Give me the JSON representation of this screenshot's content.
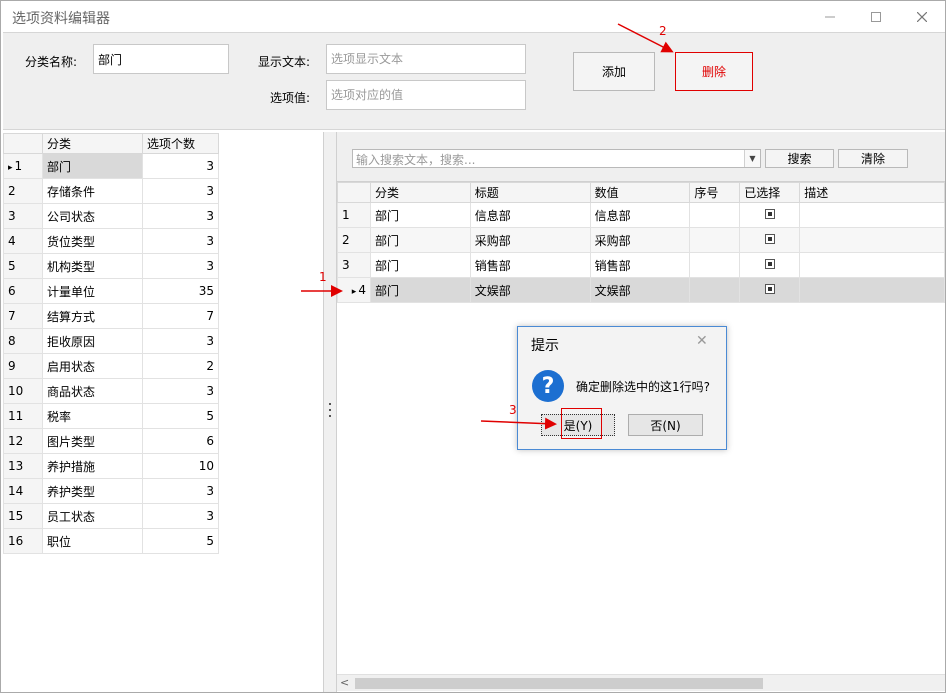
{
  "window": {
    "title": "选项资料编辑器",
    "min_glyph": "—",
    "max_glyph": "☐",
    "close_glyph": "✕"
  },
  "form": {
    "category_label": "分类名称:",
    "category_value": "部门",
    "display_label": "显示文本:",
    "display_placeholder": "选项显示文本",
    "value_label": "选项值:",
    "value_placeholder": "选项对应的值",
    "add_button": "添加",
    "delete_button": "删除"
  },
  "left_grid": {
    "columns": [
      "分类",
      "选项个数"
    ],
    "current_row_marker": "▸",
    "rows": [
      {
        "no": "1",
        "name": "部门",
        "count": "3"
      },
      {
        "no": "2",
        "name": "存储条件",
        "count": "3"
      },
      {
        "no": "3",
        "name": "公司状态",
        "count": "3"
      },
      {
        "no": "4",
        "name": "货位类型",
        "count": "3"
      },
      {
        "no": "5",
        "name": "机构类型",
        "count": "3"
      },
      {
        "no": "6",
        "name": "计量单位",
        "count": "35"
      },
      {
        "no": "7",
        "name": "结算方式",
        "count": "7"
      },
      {
        "no": "8",
        "name": "拒收原因",
        "count": "3"
      },
      {
        "no": "9",
        "name": "启用状态",
        "count": "2"
      },
      {
        "no": "10",
        "name": "商品状态",
        "count": "3"
      },
      {
        "no": "11",
        "name": "税率",
        "count": "5"
      },
      {
        "no": "12",
        "name": "图片类型",
        "count": "6"
      },
      {
        "no": "13",
        "name": "养护措施",
        "count": "10"
      },
      {
        "no": "14",
        "name": "养护类型",
        "count": "3"
      },
      {
        "no": "15",
        "name": "员工状态",
        "count": "3"
      },
      {
        "no": "16",
        "name": "职位",
        "count": "5"
      }
    ]
  },
  "search": {
    "placeholder": "输入搜索文本，搜索...",
    "search_button": "搜索",
    "clear_button": "清除",
    "dropdown_glyph": "▼"
  },
  "right_grid": {
    "columns": [
      "分类",
      "标题",
      "数值",
      "序号",
      "已选择",
      "描述"
    ],
    "current_row_marker": "▸",
    "rows": [
      {
        "no": "1",
        "category": "部门",
        "title": "信息部",
        "value": "信息部",
        "seq": "",
        "checked": true,
        "desc": ""
      },
      {
        "no": "2",
        "category": "部门",
        "title": "采购部",
        "value": "采购部",
        "seq": "",
        "checked": true,
        "desc": ""
      },
      {
        "no": "3",
        "category": "部门",
        "title": "销售部",
        "value": "销售部",
        "seq": "",
        "checked": true,
        "desc": ""
      },
      {
        "no": "4",
        "category": "部门",
        "title": "文娱部",
        "value": "文娱部",
        "seq": "",
        "checked": true,
        "desc": ""
      }
    ],
    "scroll_left_glyph": "<"
  },
  "dialog": {
    "title": "提示",
    "close_glyph": "✕",
    "icon_glyph": "?",
    "message": "确定删除选中的这1行吗?",
    "yes_button": "是(Y)",
    "no_button": "否(N)"
  },
  "annotations": {
    "step1": "1",
    "step2": "2",
    "step3": "3",
    "color": "#e00000"
  }
}
